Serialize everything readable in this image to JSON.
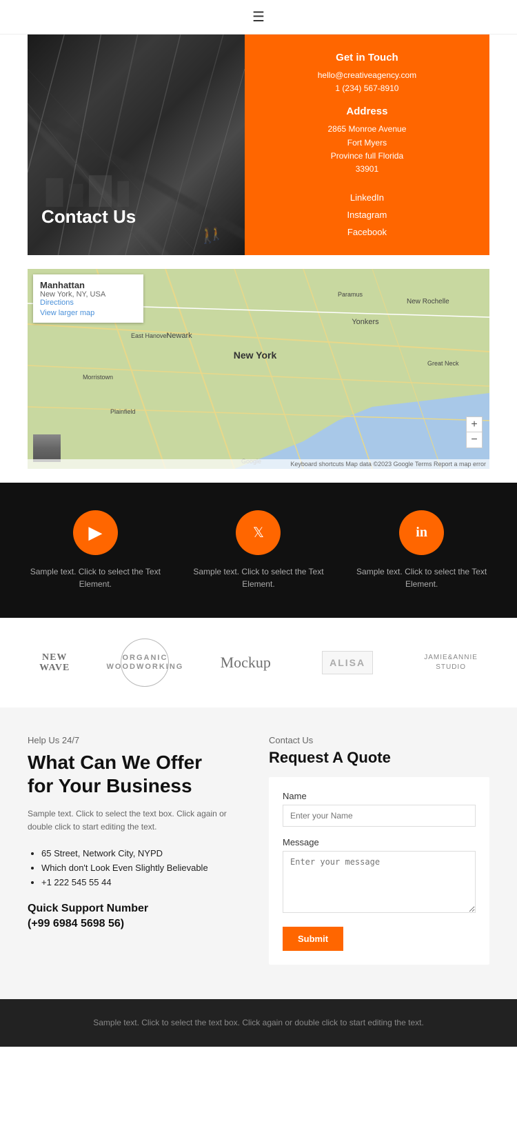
{
  "header": {
    "menu_icon": "☰"
  },
  "contact_hero": {
    "title": "Contact Us",
    "info": {
      "get_in_touch_label": "Get in Touch",
      "email": "hello@creativeagency.com",
      "phone": "1 (234) 567-8910",
      "address_label": "Address",
      "address_line1": "2865 Monroe Avenue",
      "address_line2": "Fort Myers",
      "address_line3": "Province full Florida",
      "address_line4": "33901",
      "social_linkedin": "LinkedIn",
      "social_instagram": "Instagram",
      "social_facebook": "Facebook"
    }
  },
  "map": {
    "location_name": "Manhattan",
    "location_sub": "New York, NY, USA",
    "directions_label": "Directions",
    "view_larger_label": "View larger map",
    "zoom_in": "+",
    "zoom_out": "−",
    "footer_text": "Keyboard shortcuts  Map data ©2023 Google  Terms  Report a map error"
  },
  "social_section": {
    "items": [
      {
        "icon": "▶",
        "platform": "youtube",
        "text": "Sample text. Click to select the Text Element."
      },
      {
        "icon": "🐦",
        "platform": "twitter",
        "text": "Sample text. Click to select the Text Element."
      },
      {
        "icon": "in",
        "platform": "linkedin",
        "text": "Sample text. Click to select the Text Element."
      }
    ]
  },
  "logos": {
    "items": [
      {
        "type": "newwave",
        "text_line1": "NEW",
        "text_line2": "WAVE"
      },
      {
        "type": "organic",
        "text": "ORGANIC WOODWORKING"
      },
      {
        "type": "mockup",
        "text": "Mockup"
      },
      {
        "type": "alisa",
        "text": "Alisa"
      },
      {
        "type": "jamie",
        "text_line1": "JAMIE&ANNIE",
        "text_line2": "STUDIO"
      }
    ]
  },
  "help": {
    "subtitle": "Help Us 24/7",
    "title_line1": "What Can We Offer",
    "title_line2": "for Your Business",
    "description": "Sample text. Click to select the text box. Click again or double click to start editing the text.",
    "list_items": [
      "65 Street, Network City, NYPD",
      "Which don't Look Even Slightly Believable",
      "+1 222 545 55 44"
    ],
    "quick_support_label": "Quick Support Number",
    "quick_support_number": "(+99 6984 5698 56)"
  },
  "contact_form": {
    "section_label": "Contact Us",
    "title": "Request A Quote",
    "name_label": "Name",
    "name_placeholder": "Enter your Name",
    "message_label": "Message",
    "message_placeholder": "Enter your message",
    "submit_label": "Submit"
  },
  "footer": {
    "text": "Sample text. Click to select the text box. Click again or double click to start editing the text."
  }
}
